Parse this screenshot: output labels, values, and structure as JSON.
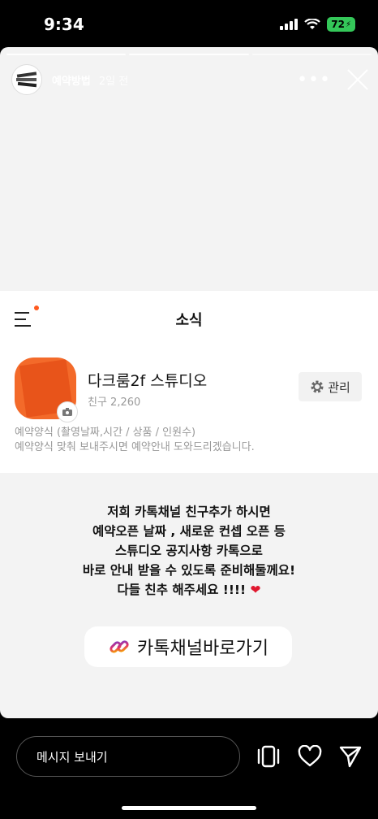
{
  "status_bar": {
    "time": "9:34",
    "battery": "72"
  },
  "story": {
    "username": "예약방법",
    "post_age": "2일 전",
    "progress_segments": 3
  },
  "kakao_channel": {
    "page_title": "소식",
    "channel_name": "다크룸2f 스튜디오",
    "friends": "친구 2,260",
    "manage_label": "관리",
    "desc_line1": "예약양식 (촬영날짜,시간 / 상품 / 인원수)",
    "desc_line2": "예약양식 맞춰 보내주시면 예약안내 도와드리겠습니다."
  },
  "story_text": {
    "line1": "저희 카톡채널 친구추가 하시면",
    "line2": "예약오픈 날짜 , 새로운 컨셉 오픈 등",
    "line3": "스튜디오 공지사항 카톡으로",
    "line4": "바로 안내 받을 수 있도록 준비해둘께요!",
    "line5": "다들 친추 해주세요 !!!!"
  },
  "link_sticker": {
    "label": "카톡채널바로가기"
  },
  "bottom_bar": {
    "message_placeholder": "메시지 보내기"
  }
}
